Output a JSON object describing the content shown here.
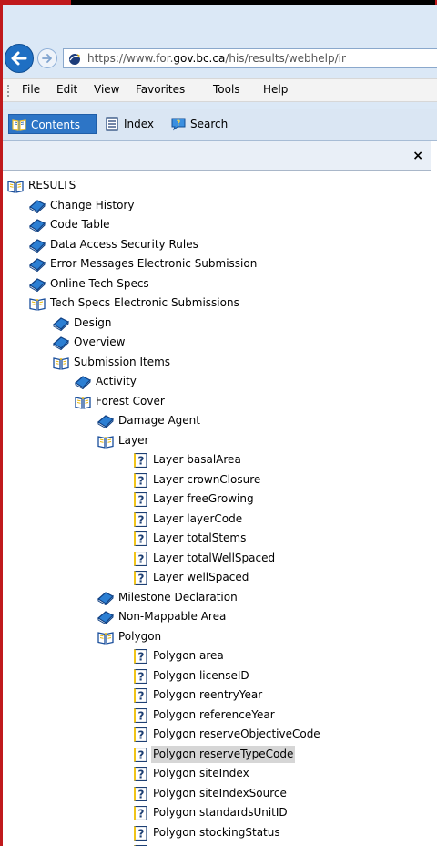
{
  "browser": {
    "url_prefix": "https://www.for.",
    "url_domain": "gov.bc.ca",
    "url_path": "/his/results/webhelp/ir"
  },
  "menu": [
    "File",
    "Edit",
    "View",
    "Favorites",
    "Tools",
    "Help"
  ],
  "tabs": [
    {
      "label": "Contents",
      "icon": "book-icon",
      "active": true
    },
    {
      "label": "Index",
      "icon": "index-list-icon",
      "active": false
    },
    {
      "label": "Search",
      "icon": "search-chat-icon",
      "active": false
    }
  ],
  "pane": {
    "close": "×"
  },
  "tree": [
    {
      "label": "RESULTS",
      "type": "book-open",
      "level": 0
    },
    {
      "label": "Change History",
      "type": "book",
      "level": 1
    },
    {
      "label": "Code Table",
      "type": "book",
      "level": 1
    },
    {
      "label": "Data Access Security Rules",
      "type": "book",
      "level": 1
    },
    {
      "label": "Error Messages Electronic Submission",
      "type": "book",
      "level": 1
    },
    {
      "label": "Online Tech Specs",
      "type": "book",
      "level": 1
    },
    {
      "label": "Tech Specs Electronic Submissions",
      "type": "book-open",
      "level": 1
    },
    {
      "label": "Design",
      "type": "book",
      "level": 2
    },
    {
      "label": "Overview",
      "type": "book",
      "level": 2
    },
    {
      "label": "Submission Items",
      "type": "book-open",
      "level": 2
    },
    {
      "label": "Activity",
      "type": "book",
      "level": 3
    },
    {
      "label": "Forest Cover",
      "type": "book-open",
      "level": 3
    },
    {
      "label": "Damage Agent",
      "type": "book",
      "level": 4
    },
    {
      "label": "Layer",
      "type": "book-open",
      "level": 4
    },
    {
      "label": "Layer basalArea",
      "type": "page",
      "level": 5
    },
    {
      "label": "Layer crownClosure",
      "type": "page",
      "level": 5
    },
    {
      "label": "Layer freeGrowing",
      "type": "page",
      "level": 5
    },
    {
      "label": "Layer layerCode",
      "type": "page",
      "level": 5
    },
    {
      "label": "Layer totalStems",
      "type": "page",
      "level": 5
    },
    {
      "label": "Layer totalWellSpaced",
      "type": "page",
      "level": 5
    },
    {
      "label": "Layer wellSpaced",
      "type": "page",
      "level": 5
    },
    {
      "label": "Milestone Declaration",
      "type": "book",
      "level": 4
    },
    {
      "label": "Non-Mappable Area",
      "type": "book",
      "level": 4
    },
    {
      "label": "Polygon",
      "type": "book-open",
      "level": 4
    },
    {
      "label": "Polygon area",
      "type": "page",
      "level": 5
    },
    {
      "label": "Polygon licenseID",
      "type": "page",
      "level": 5
    },
    {
      "label": "Polygon reentryYear",
      "type": "page",
      "level": 5
    },
    {
      "label": "Polygon referenceYear",
      "type": "page",
      "level": 5
    },
    {
      "label": "Polygon reserveObjectiveCode",
      "type": "page",
      "level": 5
    },
    {
      "label": "Polygon reserveTypeCode",
      "type": "page",
      "level": 5,
      "selected": true
    },
    {
      "label": "Polygon siteIndex",
      "type": "page",
      "level": 5
    },
    {
      "label": "Polygon siteIndexSource",
      "type": "page",
      "level": 5
    },
    {
      "label": "Polygon standardsUnitID",
      "type": "page",
      "level": 5
    },
    {
      "label": "Polygon stockingStatus",
      "type": "page",
      "level": 5
    },
    {
      "label": "",
      "type": "page",
      "level": 5
    }
  ]
}
